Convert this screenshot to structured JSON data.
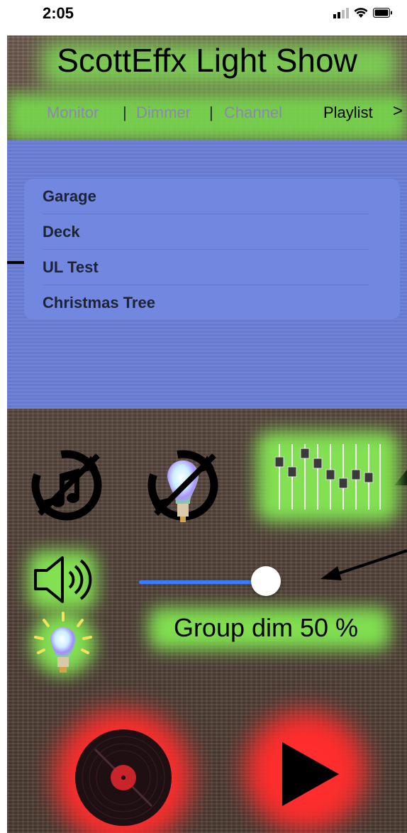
{
  "status_bar": {
    "time": "2:05",
    "icons": [
      "signal-icon",
      "wifi-icon",
      "battery-icon"
    ]
  },
  "app": {
    "title": "ScottEffx Light Show"
  },
  "nav": {
    "monitor": "Monitor",
    "separator": "|",
    "dimmer": "Dimmer",
    "channel": "Channel",
    "playlist": "Playlist",
    "chevron": ">"
  },
  "playlist": {
    "items": [
      {
        "label": "Garage"
      },
      {
        "label": "Deck"
      },
      {
        "label": "UL Test"
      },
      {
        "label": "Christmas Tree"
      }
    ]
  },
  "controls": {
    "icons": [
      "no-music-repeat-icon",
      "no-light-repeat-icon",
      "mixer-faders-icon",
      "speaker-icon",
      "light-bulb-icon",
      "record-disc-icon",
      "play-icon"
    ],
    "dim_slider_fraction": 0.5,
    "group_dim_label": "Group dim 50 %"
  },
  "colors": {
    "accent_green": "#7ed957",
    "panel_blue": "#6c7fd6",
    "slider_blue": "#3b7bff",
    "glow_red": "#ff2d2d",
    "nav_inactive": "#8e86b0"
  }
}
